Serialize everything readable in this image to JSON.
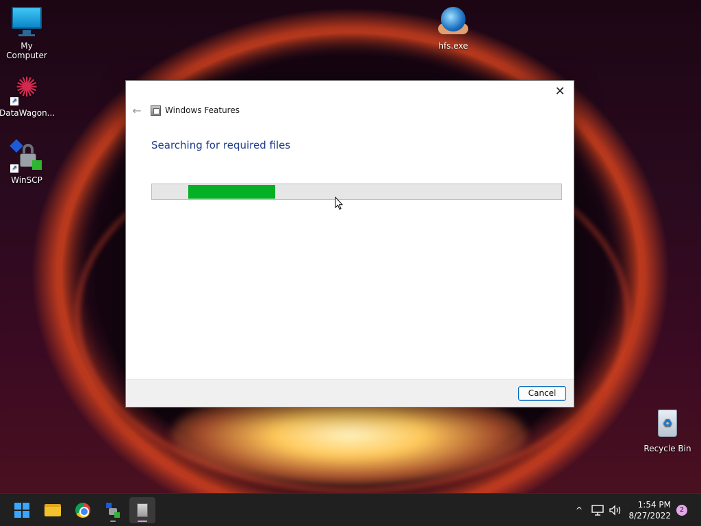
{
  "desktop": {
    "icons": [
      {
        "label": "My Computer",
        "icon": "computer-icon"
      },
      {
        "label": "DataWagon...",
        "icon": "datawagon-icon"
      },
      {
        "label": "WinSCP",
        "icon": "winscp-icon"
      },
      {
        "label": "hfs.exe",
        "icon": "hfs-icon"
      },
      {
        "label": "Recycle Bin",
        "icon": "recycle-bin-icon"
      }
    ]
  },
  "dialog": {
    "title": "Windows Features",
    "heading": "Searching for required files",
    "progress": {
      "indeterminate": true,
      "segment_start_percent": 8.8,
      "segment_width_percent": 21.3,
      "color": "#06b025"
    },
    "cancel_label": "Cancel",
    "close_glyph": "✕",
    "back_glyph": "←"
  },
  "taskbar": {
    "items": [
      {
        "name": "start",
        "icon": "windows-start-icon"
      },
      {
        "name": "file-explorer",
        "icon": "folder-icon"
      },
      {
        "name": "chrome",
        "icon": "chrome-icon"
      },
      {
        "name": "winscp",
        "icon": "winscp-icon"
      },
      {
        "name": "windows-features",
        "icon": "windows-features-icon",
        "active": true
      }
    ],
    "tray": {
      "chevron_glyph": "^",
      "time": "1:54 PM",
      "date": "8/27/2022",
      "notification_count": "2"
    }
  }
}
